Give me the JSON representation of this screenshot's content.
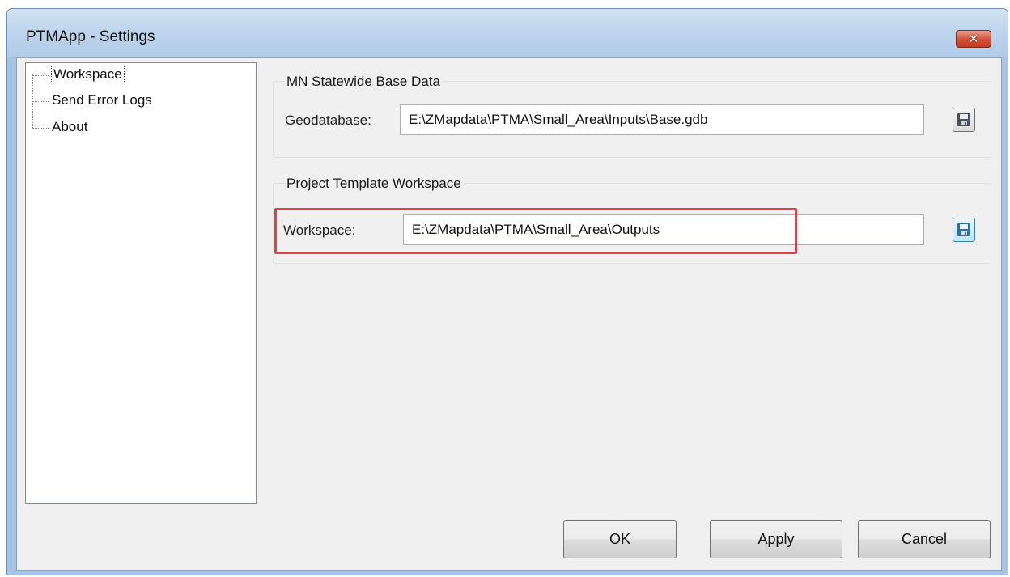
{
  "window": {
    "title": "PTMApp - Settings",
    "close_glyph": "✕"
  },
  "tree": {
    "items": [
      {
        "label": "Workspace",
        "selected": true
      },
      {
        "label": "Send Error Logs"
      },
      {
        "label": "About"
      }
    ]
  },
  "base_data": {
    "group_title": "MN Statewide Base Data",
    "field_label": "Geodatabase:",
    "field_value": "E:\\ZMapdata\\PTMA\\Small_Area\\Inputs\\Base.gdb",
    "save_icon": "floppy-disk-icon"
  },
  "template_workspace": {
    "group_title": "Project Template Workspace",
    "field_label": "Workspace:",
    "field_value": "E:\\ZMapdata\\PTMA\\Small_Area\\Outputs",
    "save_icon": "floppy-disk-icon",
    "highlight_color": "#d9434a"
  },
  "buttons": {
    "ok": "OK",
    "apply": "Apply",
    "cancel": "Cancel"
  }
}
